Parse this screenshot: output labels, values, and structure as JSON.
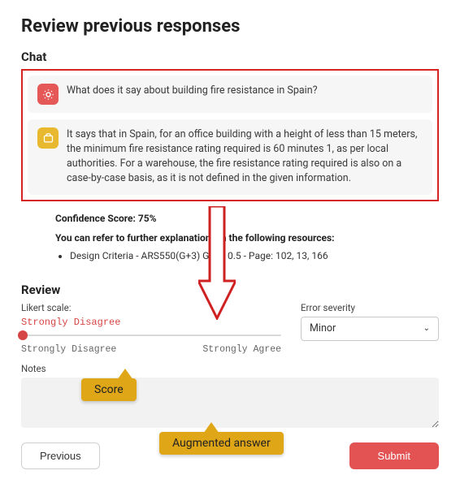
{
  "page_title": "Review previous responses",
  "chat": {
    "section_title": "Chat",
    "user_message": "What does it say about building fire resistance in Spain?",
    "bot_message": "It says that in Spain, for an office building with a height of less than 15 meters, the minimum fire resistance rating required is 60 minutes 1, as per local authorities. For a warehouse, the fire resistance rating required is also on a case-by-case basis, as it is not defined in the given information."
  },
  "details": {
    "confidence_label": "Confidence Score: 75%",
    "refer_label": "You can refer to further explanations in the following resources:",
    "resources": [
      "Design Criteria - ARS550(G+3) Gen 10.5 - Page: 102, 13, 166"
    ]
  },
  "review": {
    "section_title": "Review",
    "likert": {
      "label": "Likert scale:",
      "value": "Strongly Disagree",
      "min_label": "Strongly Disagree",
      "max_label": "Strongly Agree"
    },
    "error_severity": {
      "label": "Error severity",
      "value": "Minor"
    },
    "notes": {
      "label": "Notes",
      "value": ""
    },
    "buttons": {
      "previous": "Previous",
      "submit": "Submit"
    }
  },
  "annotations": {
    "score_callout": "Score",
    "augmented_callout": "Augmented answer"
  }
}
